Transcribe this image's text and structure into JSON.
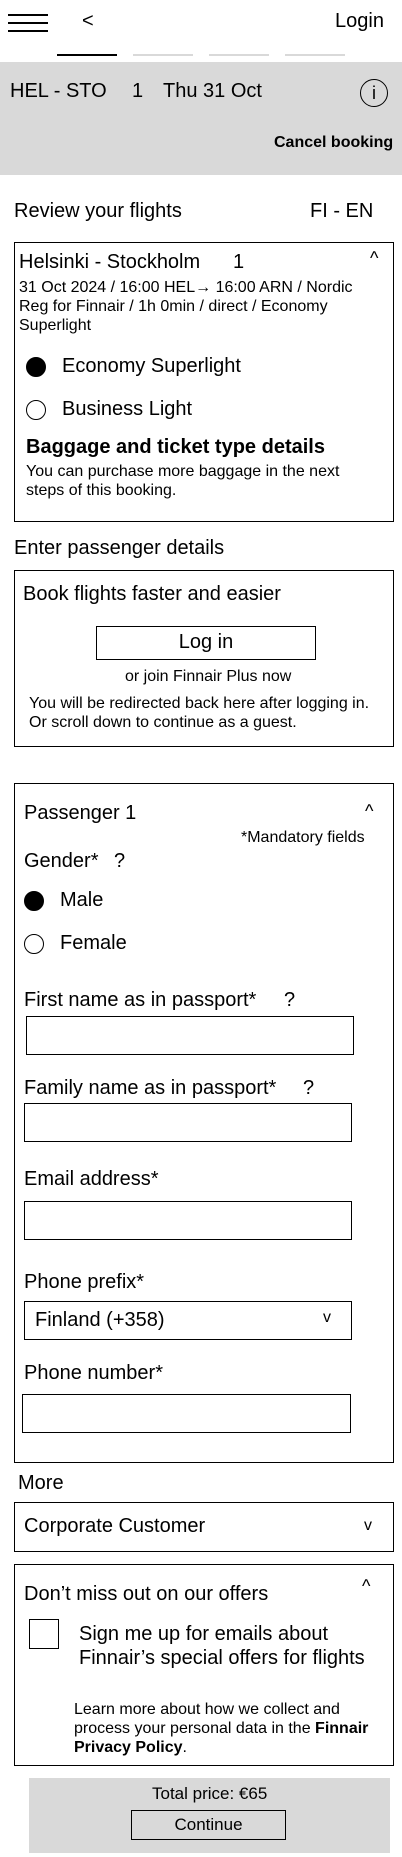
{
  "header": {
    "back_label": "<",
    "login_label": "Login"
  },
  "trip_bar": {
    "route": "HEL - STO",
    "passengers": "1",
    "date": "Thu 31 Oct",
    "info_icon": "i",
    "cancel_label": "Cancel booking"
  },
  "review": {
    "title": "Review your flights",
    "language": "FI - EN"
  },
  "flight": {
    "route": "Helsinki - Stockholm",
    "passengers": "1",
    "collapse_icon": "^",
    "details": "31 Oct 2024 / 16:00 HEL→ 16:00 ARN / Nordic Reg for Finnair / 1h 0min / direct / Economy Superlight",
    "fare_options": [
      {
        "label": "Economy Superlight",
        "selected": true
      },
      {
        "label": "Business Light",
        "selected": false
      }
    ],
    "baggage_title": "Baggage and ticket type details",
    "baggage_text": "You can purchase more baggage in the next steps of this booking."
  },
  "passenger_section": {
    "title": "Enter passenger details"
  },
  "login_box": {
    "title": "Book flights faster and easier",
    "login_button": "Log in",
    "join_text": "or join Finnair Plus now",
    "redirect_text": "You will be redirected back here after logging in. Or scroll down to continue as a guest."
  },
  "passenger_form": {
    "title": "Passenger 1",
    "collapse_icon": "^",
    "mandatory_note": "*Mandatory fields",
    "gender_label": "Gender*",
    "help_icon": "?",
    "gender_options": [
      {
        "label": "Male",
        "selected": true
      },
      {
        "label": "Female",
        "selected": false
      }
    ],
    "first_name_label": "First name as in passport*",
    "first_name_value": "",
    "family_name_label": "Family name as in passport*",
    "family_name_value": "",
    "email_label": "Email address*",
    "email_value": "",
    "phone_prefix_label": "Phone prefix*",
    "phone_prefix_value": "Finland (+358)",
    "dropdown_icon": "v",
    "phone_number_label": "Phone number*",
    "phone_number_value": ""
  },
  "more": {
    "title": "More",
    "corporate_label": "Corporate Customer",
    "dropdown_icon": "v"
  },
  "offers": {
    "title": "Don’t miss out on our offers",
    "collapse_icon": "^",
    "signup_label": "Sign me up for emails about Finnair’s special offers for flights",
    "privacy_text": "Learn more about how we collect and process your personal data in the",
    "privacy_link": "Finnair Privacy Policy",
    "privacy_end": "."
  },
  "footer": {
    "total_price": "Total price: €65",
    "continue_label": "Continue"
  }
}
